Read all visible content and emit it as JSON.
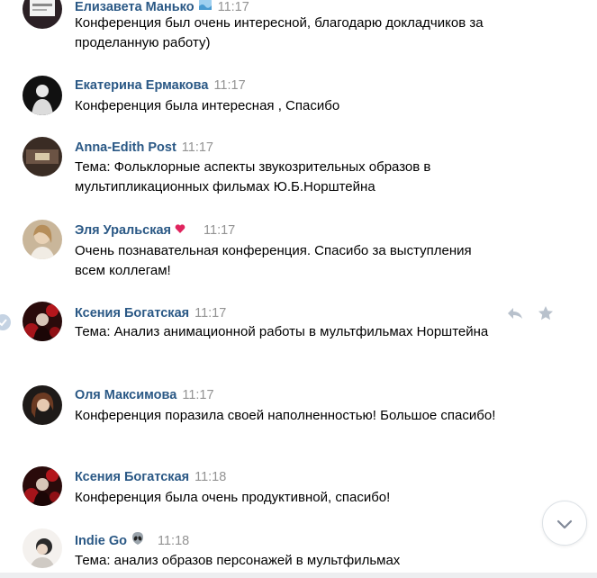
{
  "messages": [
    {
      "author": "Елизавета Манько",
      "emoji": "wave-emoji",
      "time": "11:17",
      "text": "Конференция был очень интересной, благодарю докладчиков за проделанную работу)"
    },
    {
      "author": "Екатерина Ермакова",
      "time": "11:17",
      "text": "Конференция была интересная , Спасибо"
    },
    {
      "author": "Anna-Edith Post",
      "time": "11:17",
      "text": "Тема: Фольклорные аспекты звукозрительных образов в мультипликационных фильмах Ю.Б.Норштейна"
    },
    {
      "author": "Эля Уральская",
      "emoji": "heart-emoji",
      "emoji_color": "#e0245e",
      "time": "11:17",
      "text": "Очень познавательная конференция. Спасибо за выступления всем коллегам!"
    },
    {
      "author": "Ксения Богатская",
      "time": "11:17",
      "text": "Тема: Анализ анимационной работы в мультфильмах Норштейна"
    },
    {
      "author": "Оля Максимова",
      "time": "11:17",
      "text": "Конференция поразила своей наполненностью! Большое спасибо!"
    },
    {
      "author": "Ксения Богатская",
      "time": "11:18",
      "text": "Конференция была очень продуктивной, спасибо!"
    },
    {
      "author": "Indie Go",
      "emoji": "alien-emoji",
      "time": "11:18",
      "text": "Тема: анализ образов персонажей в мультфильмах"
    }
  ],
  "actions": {
    "reply_icon": "reply-icon",
    "star_icon": "star-icon"
  },
  "scroll_button_icon": "chevron-down-icon",
  "colors": {
    "author": "#2a5885",
    "time": "#939393",
    "text": "#000000",
    "icon_gray": "#b8c1cc",
    "read_check": "#c5d3e3"
  }
}
